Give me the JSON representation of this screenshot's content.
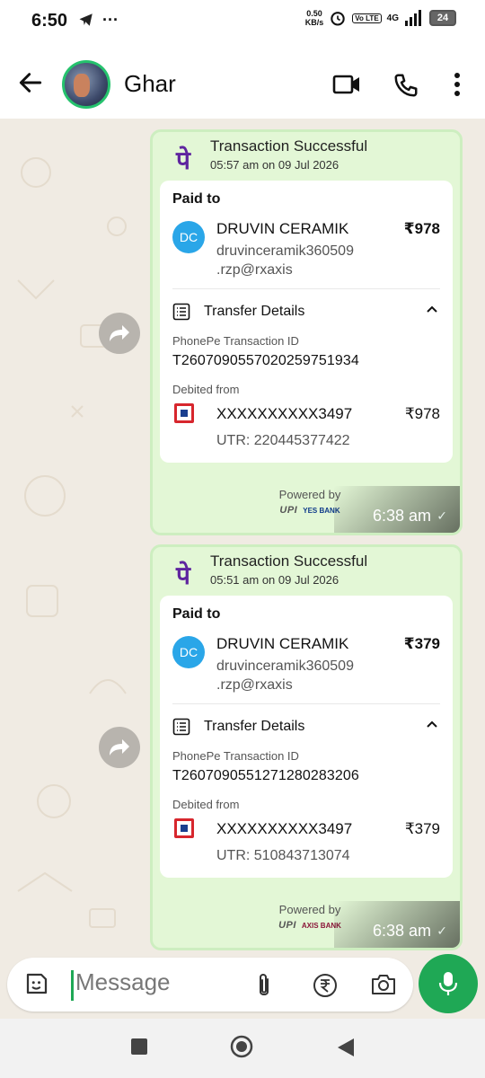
{
  "status": {
    "time": "6:50",
    "speed_value": "0.50",
    "speed_unit": "KB/s",
    "volte": "Vo LTE",
    "network": "4G",
    "battery": "24"
  },
  "header": {
    "title": "Ghar"
  },
  "messages": [
    {
      "title": "Transaction Successful",
      "subtitle": "05:57 am on 09 Jul 2026",
      "paid_label": "Paid to",
      "initials": "DC",
      "payee": "DRUVIN CERAMIK",
      "upi_line1": "druvinceramik360509",
      "upi_line2": ".rzp@rxaxis",
      "amount": "₹978",
      "transfer_label": "Transfer Details",
      "txid_label": "PhonePe Transaction ID",
      "txid": "T2607090557020259751934",
      "debited_label": "Debited from",
      "account": "XXXXXXXXXX3497",
      "debited_amount": "₹978",
      "utr": "UTR: 220445377422",
      "powered_by": "Powered by",
      "upi_logo": "UPI",
      "bank_logo": "YES BANK",
      "time": "6:38 am",
      "tick": "✓"
    },
    {
      "title": "Transaction Successful",
      "subtitle": "05:51 am on 09 Jul 2026",
      "paid_label": "Paid to",
      "initials": "DC",
      "payee": "DRUVIN CERAMIK",
      "upi_line1": "druvinceramik360509",
      "upi_line2": ".rzp@rxaxis",
      "amount": "₹379",
      "transfer_label": "Transfer Details",
      "txid_label": "PhonePe Transaction ID",
      "txid": "T2607090551271280283206",
      "debited_label": "Debited from",
      "account": "XXXXXXXXXX3497",
      "debited_amount": "₹379",
      "utr": "UTR: 510843713074",
      "powered_by": "Powered by",
      "upi_logo": "UPI",
      "bank_logo": "AXIS BANK",
      "time": "6:38 am",
      "tick": "✓"
    }
  ],
  "input": {
    "placeholder": "Message"
  },
  "colors": {
    "whatsapp_green": "#1fa855",
    "phonepe_purple": "#5f259f",
    "bubble": "#e3f7d6",
    "chat_bg": "#f0ebe3"
  },
  "icons": [
    "telegram-icon",
    "more-dots-icon",
    "alarm-icon",
    "signal-icon",
    "battery-icon",
    "back-arrow-icon",
    "video-call-icon",
    "phone-icon",
    "kebab-menu-icon",
    "forward-icon",
    "phonepe-logo",
    "list-icon",
    "chevron-up-icon",
    "bank-icon",
    "sticker-icon",
    "attach-icon",
    "rupee-icon",
    "camera-icon",
    "mic-icon",
    "nav-recents-icon",
    "nav-home-icon",
    "nav-back-icon"
  ]
}
